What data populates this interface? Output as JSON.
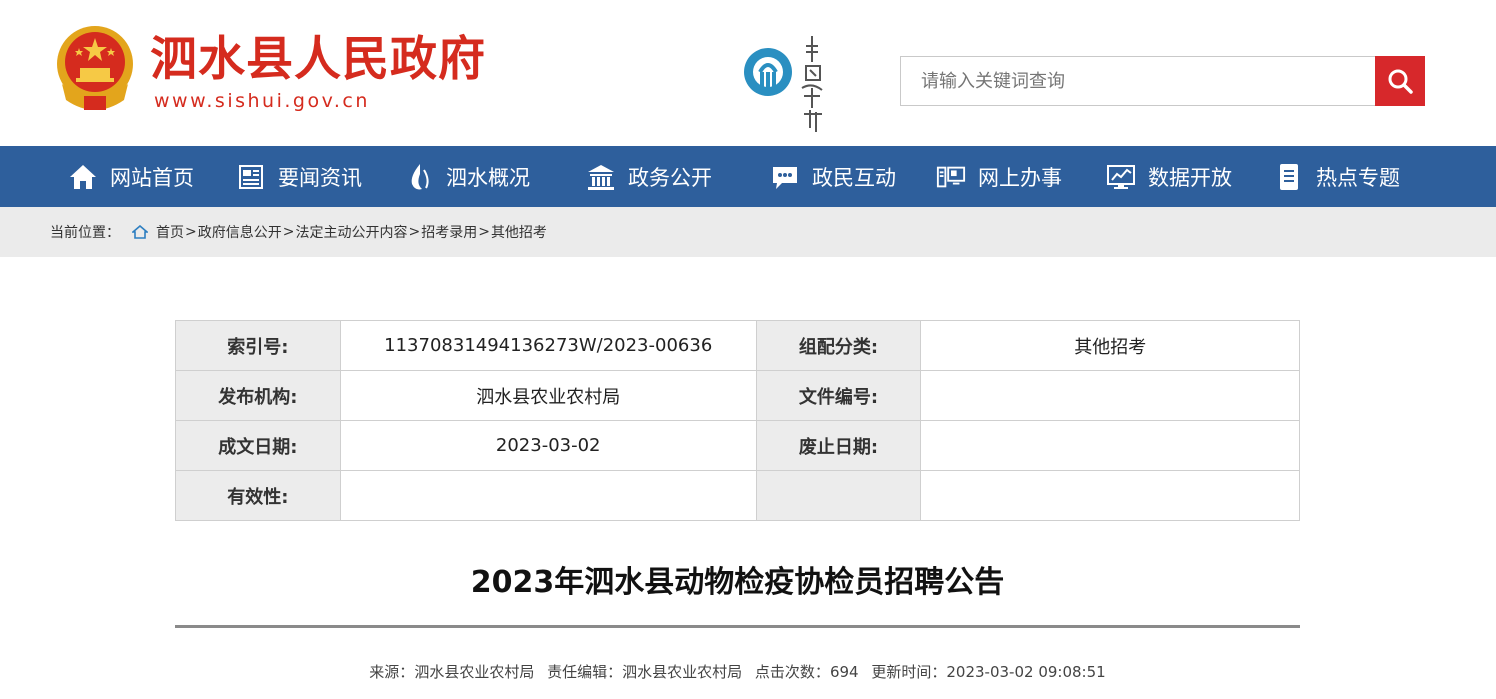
{
  "header": {
    "site_title": "泗水县人民政府",
    "site_url": "www.sishui.gov.cn",
    "emblem_icon": "national-emblem-icon",
    "hometown_logo_icon": "china-hometown-logo-icon",
    "search": {
      "placeholder": "请输入关键词查询",
      "value": ""
    },
    "search_icon": "magnifier-icon"
  },
  "colors": {
    "brand_red": "#d52b1e",
    "nav_blue": "#2e5f9c",
    "search_button": "#d7282b",
    "breadcrumb_bg": "#ebebeb"
  },
  "nav": {
    "items": [
      {
        "label": "网站首页",
        "icon": "home-icon"
      },
      {
        "label": "要闻资讯",
        "icon": "news-icon"
      },
      {
        "label": "泗水概况",
        "icon": "water-drop-icon"
      },
      {
        "label": "政务公开",
        "icon": "government-building-icon"
      },
      {
        "label": "政民互动",
        "icon": "chat-bubble-icon"
      },
      {
        "label": "网上办事",
        "icon": "online-service-icon"
      },
      {
        "label": "数据开放",
        "icon": "data-monitor-icon"
      },
      {
        "label": "热点专题",
        "icon": "topic-list-icon"
      }
    ]
  },
  "breadcrumb": {
    "prefix": "当前位置：",
    "items": [
      "首页",
      "政府信息公开",
      "法定主动公开内容",
      "招考录用",
      "其他招考"
    ],
    "separator": ">"
  },
  "info_table": {
    "rows": [
      {
        "label1": "索引号:",
        "value1": "11370831494136273W/2023-00636",
        "label2": "组配分类:",
        "value2": "其他招考"
      },
      {
        "label1": "发布机构:",
        "value1": "泗水县农业农村局",
        "label2": "文件编号:",
        "value2": ""
      },
      {
        "label1": "成文日期:",
        "value1": "2023-03-02",
        "label2": "废止日期:",
        "value2": ""
      },
      {
        "label1": "有效性:",
        "value1": "",
        "label2": "",
        "value2": ""
      }
    ]
  },
  "article": {
    "title": "2023年泗水县动物检疫协检员招聘公告",
    "meta": {
      "source_label": "来源：",
      "source": "泗水县农业农村局",
      "editor_label": "责任编辑：",
      "editor": "泗水县农业农村局",
      "clicks_label": "点击次数：",
      "clicks": "694",
      "updated_label": "更新时间：",
      "updated": "2023-03-02 09:08:51"
    }
  }
}
